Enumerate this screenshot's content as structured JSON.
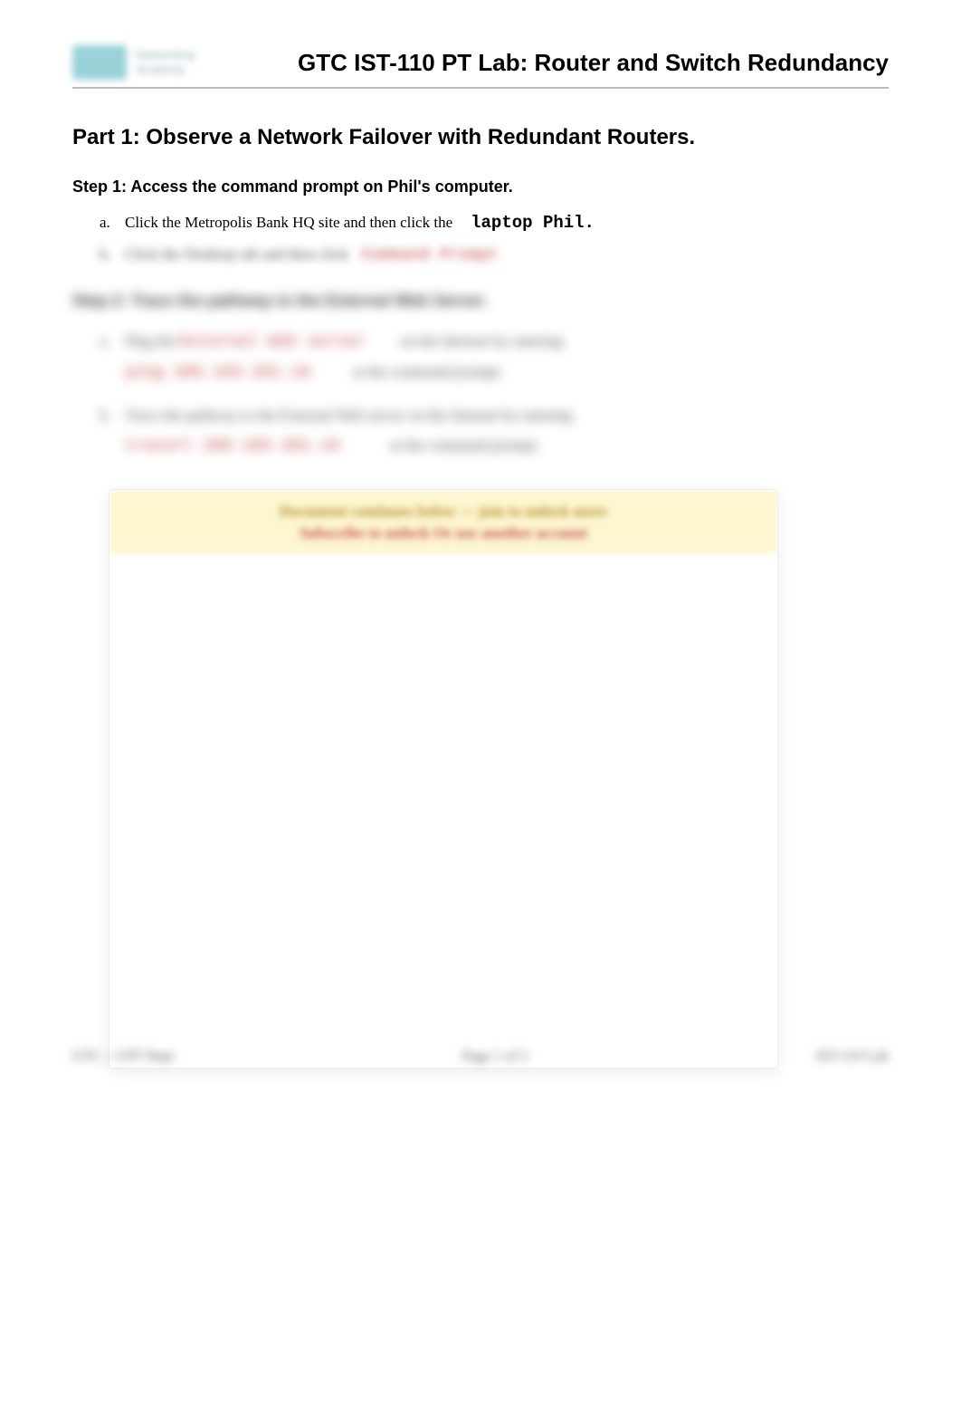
{
  "header": {
    "logo_alt": "Networking",
    "logo_sub": "Academy",
    "title": "GTC IST-110 PT Lab: Router and Switch Redundancy"
  },
  "part1": {
    "title": "Part 1:   Observe a Network Failover with Redundant Routers.",
    "step1": {
      "title": "Step 1:   Access the command prompt on Phil's computer.",
      "a": {
        "marker": "a.",
        "text": "Click the Metropolis Bank HQ site and then click the",
        "mono": "laptop Phil."
      },
      "b": {
        "marker": "b.",
        "text": "Click the Desktop tab and then click",
        "red": "Command Prompt"
      }
    },
    "step2": {
      "title": "Step 2:   Trace the pathway to the External Web Server.",
      "a": {
        "marker": "a.",
        "text_before": "Ping the",
        "red_line1": "External Web server",
        "text_mid": "on the Internet by entering",
        "red_line2": "ping 209.165.201.10",
        "text_after": "at the command prompt."
      },
      "b": {
        "marker": "b.",
        "text": "Trace the pathway to the External Web server on the Internet by entering",
        "red": "tracert 209.165.201.10",
        "text_after": "at the command prompt."
      }
    }
  },
  "cta": {
    "line1": "Document continues below — join to unlock more",
    "line2": "Subscribe to unlock   Or use another account"
  },
  "footer": {
    "left": "GTC – CPT Dept",
    "center": "Page  1 of 5",
    "right": "IST-110 Lab"
  }
}
